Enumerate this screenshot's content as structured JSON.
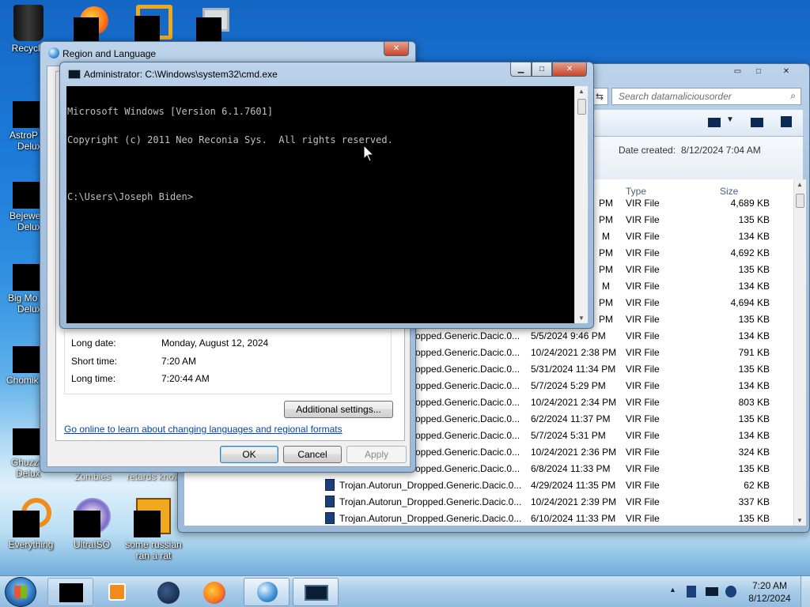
{
  "desktop": {
    "icons": [
      {
        "label": "Recycle"
      },
      {
        "label": "AstroP"
      },
      {
        "label": "Delux"
      },
      {
        "label": "Bejewe"
      },
      {
        "label": "Delux"
      },
      {
        "label": "Big Mo"
      },
      {
        "label": "Delux"
      },
      {
        "label": "Chomik"
      },
      {
        "label": "Ghuzz"
      },
      {
        "label": "Delux"
      },
      {
        "label": "Everything"
      },
      {
        "label": "UltraISO"
      },
      {
        "label": "some russian"
      },
      {
        "label": "ran a rat"
      },
      {
        "label": "Zombies"
      },
      {
        "label": "retards know"
      }
    ]
  },
  "explorer": {
    "search_placeholder": "Search datamaliciousorder",
    "date_created_label": "Date created:",
    "date_created_value": "8/12/2024 7:04 AM",
    "columns": {
      "type": "Type",
      "size": "Size"
    },
    "partial_rows": [
      {
        "date": "PM",
        "type": "VIR File",
        "size": "4,689 KB"
      },
      {
        "date": "PM",
        "type": "VIR File",
        "size": "135 KB"
      },
      {
        "date": "M",
        "type": "VIR File",
        "size": "134 KB"
      },
      {
        "date": "PM",
        "type": "VIR File",
        "size": "4,692 KB"
      },
      {
        "date": "PM",
        "type": "VIR File",
        "size": "135 KB"
      },
      {
        "date": "M",
        "type": "VIR File",
        "size": "134 KB"
      },
      {
        "date": "PM",
        "type": "VIR File",
        "size": "4,694 KB"
      },
      {
        "date": "PM",
        "type": "VIR File",
        "size": "135 KB"
      }
    ],
    "rows": [
      {
        "name": "opped.Generic.Dacic.0...",
        "date": "5/5/2024 9:46 PM",
        "type": "VIR File",
        "size": "134 KB"
      },
      {
        "name": "opped.Generic.Dacic.0...",
        "date": "10/24/2021 2:38 PM",
        "type": "VIR File",
        "size": "791 KB"
      },
      {
        "name": "opped.Generic.Dacic.0...",
        "date": "5/31/2024 11:34 PM",
        "type": "VIR File",
        "size": "135 KB"
      },
      {
        "name": "opped.Generic.Dacic.0...",
        "date": "5/7/2024 5:29 PM",
        "type": "VIR File",
        "size": "134 KB"
      },
      {
        "name": "opped.Generic.Dacic.0...",
        "date": "10/24/2021 2:34 PM",
        "type": "VIR File",
        "size": "803 KB"
      },
      {
        "name": "opped.Generic.Dacic.0...",
        "date": "6/2/2024 11:37 PM",
        "type": "VIR File",
        "size": "135 KB"
      },
      {
        "name": "opped.Generic.Dacic.0...",
        "date": "5/7/2024 5:31 PM",
        "type": "VIR File",
        "size": "134 KB"
      },
      {
        "name": "opped.Generic.Dacic.0...",
        "date": "10/24/2021 2:36 PM",
        "type": "VIR File",
        "size": "324 KB"
      },
      {
        "name": "opped.Generic.Dacic.0...",
        "date": "6/8/2024 11:33 PM",
        "type": "VIR File",
        "size": "135 KB"
      },
      {
        "name": "Trojan.Autorun_Dropped.Generic.Dacic.0...",
        "date": "4/29/2024 11:35 PM",
        "type": "VIR File",
        "size": "62 KB"
      },
      {
        "name": "Trojan.Autorun_Dropped.Generic.Dacic.0...",
        "date": "10/24/2021 2:39 PM",
        "type": "VIR File",
        "size": "337 KB"
      },
      {
        "name": "Trojan.Autorun_Dropped.Generic.Dacic.0...",
        "date": "6/10/2024 11:33 PM",
        "type": "VIR File",
        "size": "135 KB"
      }
    ]
  },
  "region_dialog": {
    "title": "Region and Language",
    "long_date_label": "Long date:",
    "long_date_value": "Monday, August 12, 2024",
    "short_time_label": "Short time:",
    "short_time_value": "7:20 AM",
    "long_time_label": "Long time:",
    "long_time_value": "7:20:44 AM",
    "additional_settings": "Additional settings...",
    "online_link": "Go online to learn about changing languages and regional formats",
    "ok": "OK",
    "cancel": "Cancel",
    "apply": "Apply"
  },
  "cmd": {
    "title": "Administrator: C:\\Windows\\system32\\cmd.exe",
    "lines": [
      "Microsoft Windows [Version 6.1.7601]",
      "Copyright (c) 2011 Neo Reconia Sys.  All rights reserved.",
      "",
      "C:\\Users\\Joseph Biden>"
    ]
  },
  "taskbar": {
    "clock_time": "7:20 AM",
    "clock_date": "8/12/2024"
  },
  "colors": {
    "link": "#0645ad",
    "console_bg": "#000000",
    "console_fg": "#c0c0c0",
    "close_button": "#c7462d"
  }
}
